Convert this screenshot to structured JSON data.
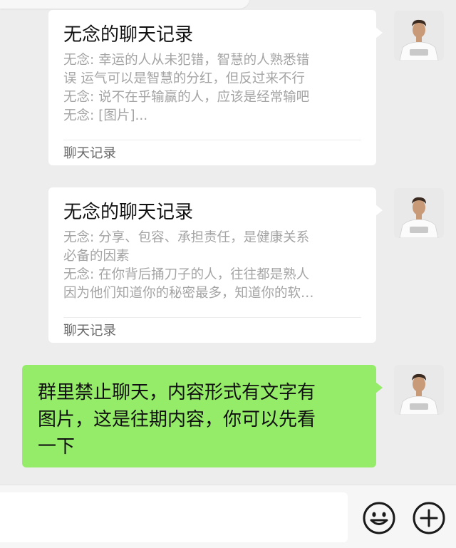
{
  "chat": {
    "cards": [
      {
        "title": "无念的聊天记录",
        "lines": [
          "无念: 幸运的人从未犯错，智慧的人熟悉错",
          "误 运气可以是智慧的分红，但反过来不行",
          "无念: 说不在乎输赢的人，应该是经常输吧",
          "无念: [图片]..."
        ],
        "footer": "聊天记录"
      },
      {
        "title": "无念的聊天记录",
        "lines": [
          "无念: 分享、包容、承担责任，是健康关系",
          "必备的因素",
          "无念: 在你背后捅刀子的人，往往都是熟人",
          "因为他们知道你的秘密最多，知道你的软…"
        ],
        "footer": "聊天记录"
      }
    ],
    "text_message": {
      "lines": [
        "群里禁止聊天，内容形式有文字有",
        "图片，这是往期内容，你可以先看",
        "一下"
      ],
      "bubble_color": "#95ec69"
    }
  },
  "input_bar": {
    "emoji_icon": "emoji-smile-icon",
    "add_icon": "plus-circle-icon"
  },
  "colors": {
    "background": "#ededed",
    "card": "#ffffff",
    "sent_bubble": "#95ec69",
    "preview_text": "#a4a4a4"
  }
}
